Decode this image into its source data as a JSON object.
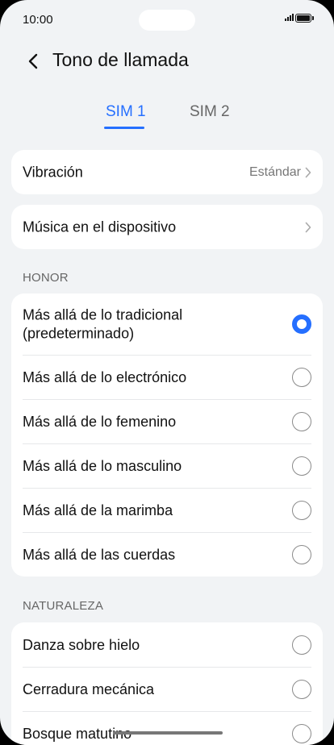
{
  "status_bar": {
    "time": "10:00"
  },
  "header": {
    "title": "Tono de llamada"
  },
  "tabs": [
    {
      "label": "SIM 1",
      "active": true
    },
    {
      "label": "SIM 2",
      "active": false
    }
  ],
  "vibration": {
    "label": "Vibración",
    "value": "Estándar"
  },
  "device_music": {
    "label": "Música en el dispositivo"
  },
  "sections": [
    {
      "title": "HONOR",
      "items": [
        {
          "label": "Más allá de lo tradicional (predeterminado)",
          "selected": true
        },
        {
          "label": "Más allá de lo electrónico",
          "selected": false
        },
        {
          "label": "Más allá de lo femenino",
          "selected": false
        },
        {
          "label": "Más allá de lo masculino",
          "selected": false
        },
        {
          "label": "Más allá de la marimba",
          "selected": false
        },
        {
          "label": "Más allá de las cuerdas",
          "selected": false
        }
      ]
    },
    {
      "title": "NATURALEZA",
      "items": [
        {
          "label": "Danza sobre hielo",
          "selected": false
        },
        {
          "label": "Cerradura mecánica",
          "selected": false
        },
        {
          "label": "Bosque matutino",
          "selected": false
        }
      ]
    }
  ],
  "colors": {
    "accent": "#256fff",
    "background": "#f1f3f5",
    "card": "#ffffff"
  }
}
